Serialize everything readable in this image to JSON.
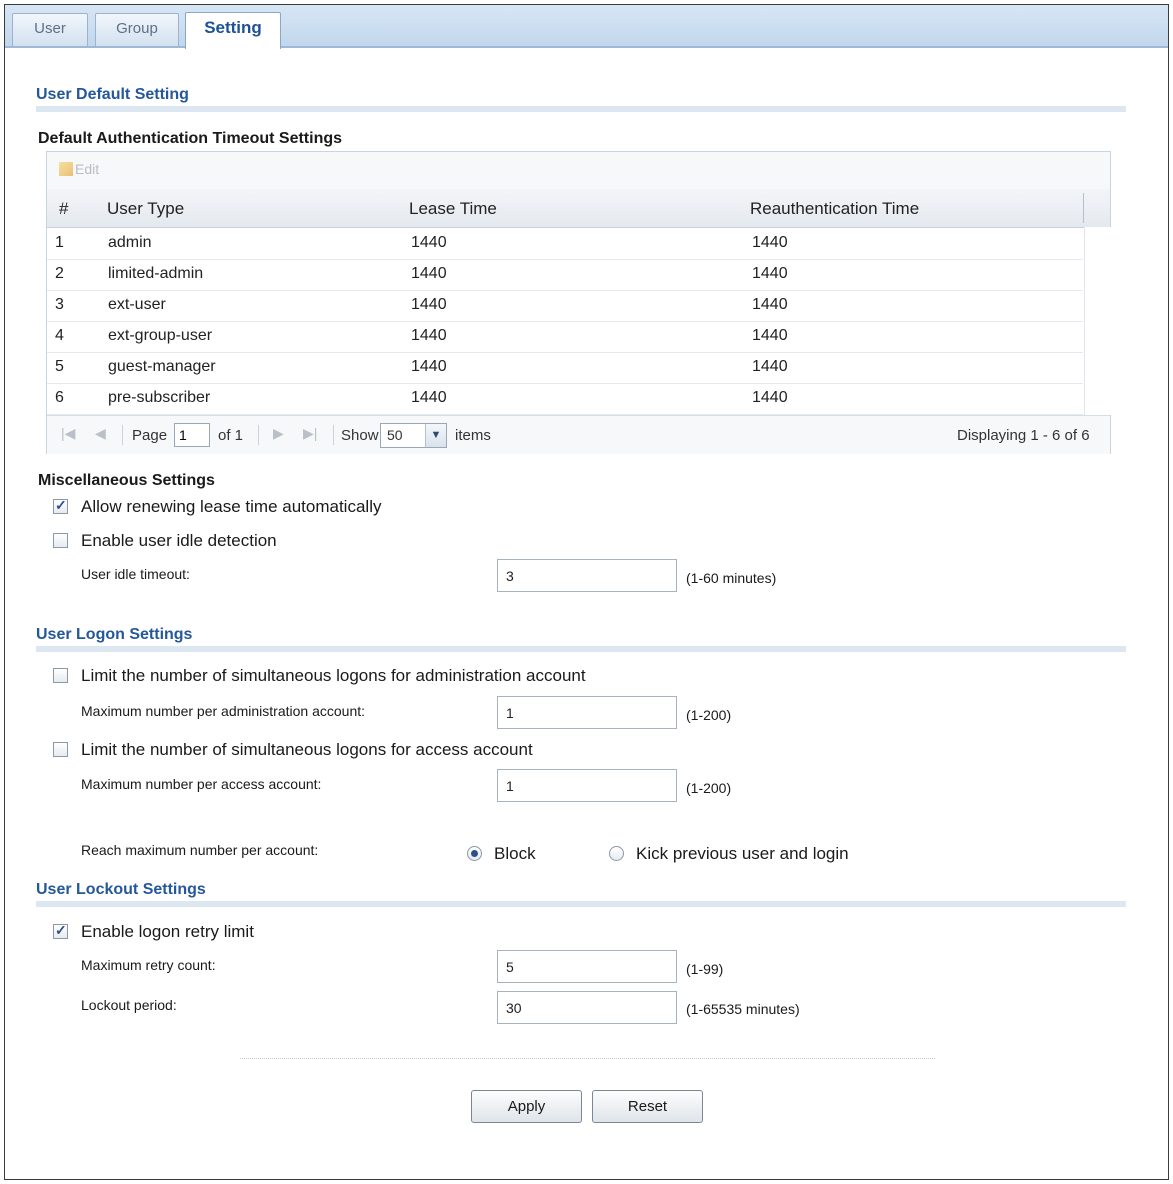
{
  "tabs": [
    {
      "label": "User"
    },
    {
      "label": "Group"
    },
    {
      "label": "Setting"
    }
  ],
  "user_default": {
    "title": "User Default Setting",
    "timeout_title": "Default Authentication Timeout Settings",
    "edit_label": "Edit",
    "columns": [
      "#",
      "User Type",
      "Lease Time",
      "Reauthentication Time"
    ],
    "rows": [
      {
        "num": "1",
        "type": "admin",
        "lease": "1440",
        "reauth": "1440"
      },
      {
        "num": "2",
        "type": "limited-admin",
        "lease": "1440",
        "reauth": "1440"
      },
      {
        "num": "3",
        "type": "ext-user",
        "lease": "1440",
        "reauth": "1440"
      },
      {
        "num": "4",
        "type": "ext-group-user",
        "lease": "1440",
        "reauth": "1440"
      },
      {
        "num": "5",
        "type": "guest-manager",
        "lease": "1440",
        "reauth": "1440"
      },
      {
        "num": "6",
        "type": "pre-subscriber",
        "lease": "1440",
        "reauth": "1440"
      }
    ],
    "pager": {
      "page_label": "Page",
      "page_value": "1",
      "of_label": "of 1",
      "show_label": "Show",
      "show_value": "50",
      "items_label": "items",
      "displaying": "Displaying 1 - 6 of 6"
    }
  },
  "misc": {
    "title": "Miscellaneous Settings",
    "renew_label": "Allow renewing lease time automatically",
    "renew_checked": true,
    "idle_label": "Enable user idle detection",
    "idle_checked": false,
    "idle_timeout_label": "User idle timeout:",
    "idle_timeout_value": "3",
    "idle_timeout_hint": "(1-60 minutes)"
  },
  "logon": {
    "title": "User Logon Settings",
    "admin_limit_label": "Limit the number of simultaneous logons for administration account",
    "admin_limit_checked": false,
    "admin_max_label": "Maximum number per administration account:",
    "admin_max_value": "1",
    "admin_max_hint": "(1-200)",
    "access_limit_label": "Limit the number of simultaneous logons for access account",
    "access_limit_checked": false,
    "access_max_label": "Maximum number per access account:",
    "access_max_value": "1",
    "access_max_hint": "(1-200)",
    "reach_label": "Reach maximum number per account:",
    "option_block": "Block",
    "option_kick": "Kick previous user and login",
    "selected_option": "Block"
  },
  "lockout": {
    "title": "User Lockout Settings",
    "retry_label": "Enable logon retry limit",
    "retry_checked": true,
    "max_retry_label": "Maximum retry count:",
    "max_retry_value": "5",
    "max_retry_hint": "(1-99)",
    "period_label": "Lockout period:",
    "period_value": "30",
    "period_hint": "(1-65535 minutes)"
  },
  "buttons": {
    "apply": "Apply",
    "reset": "Reset"
  }
}
